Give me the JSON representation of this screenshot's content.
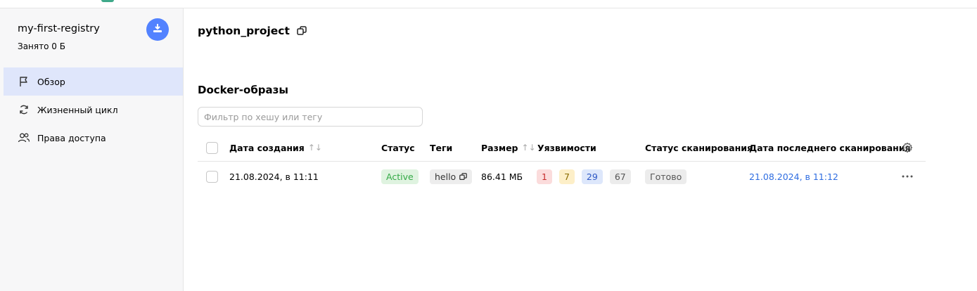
{
  "sidebar": {
    "registry_name": "my-first-registry",
    "registry_used": "Занято 0 Б",
    "items": [
      {
        "label": "Обзор",
        "icon": "flag-icon",
        "active": true
      },
      {
        "label": "Жизненный цикл",
        "icon": "refresh-icon",
        "active": false
      },
      {
        "label": "Права доступа",
        "icon": "users-icon",
        "active": false
      }
    ]
  },
  "main": {
    "project_title": "python_project",
    "section_title": "Docker-образы",
    "filter_placeholder": "Фильтр по хешу или тегу",
    "columns": {
      "created": "Дата создания",
      "status": "Статус",
      "tags": "Теги",
      "size": "Размер",
      "vulns": "Уязвимости",
      "scan_status": "Статус сканирования",
      "last_scan": "Дата последнего сканирования"
    },
    "rows": [
      {
        "created": "21.08.2024, в 11:11",
        "status": "Active",
        "tag": "hello",
        "size": "86.41 МБ",
        "vulns": {
          "critical": "1",
          "high": "7",
          "medium": "29",
          "low": "67"
        },
        "scan_status": "Готово",
        "last_scan": "21.08.2024, в 11:12"
      }
    ]
  },
  "colors": {
    "accent": "#5282ff",
    "active_nav_bg": "#dfe6fb",
    "status_active": "#32a945",
    "link": "#2f6de1"
  }
}
